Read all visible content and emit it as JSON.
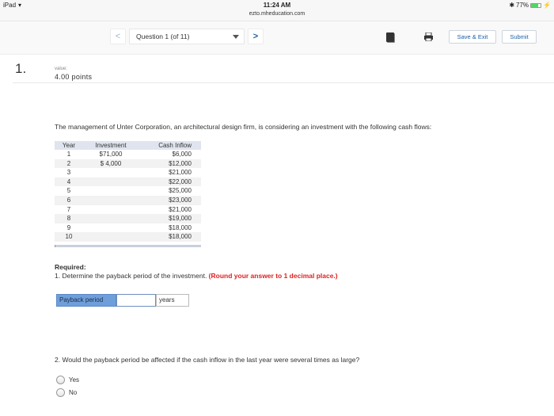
{
  "status_bar": {
    "device": "iPad",
    "time": "11:24 AM",
    "url": "ezto.mheducation.com",
    "battery_percent": "77%",
    "battery_level": 0.77
  },
  "toolbar": {
    "prev_label": "<",
    "next_label": ">",
    "question_select": "Question 1 (of 11)",
    "save_exit_label": "Save & Exit",
    "submit_label": "Submit"
  },
  "question": {
    "number": "1.",
    "value_label": "value:",
    "points": "4.00 points",
    "intro": "The management of Unter Corporation, an architectural design firm, is considering an investment with the following cash flows:",
    "table": {
      "headers": [
        "Year",
        "Investment",
        "Cash Inflow"
      ],
      "rows": [
        [
          "1",
          "$71,000",
          "$6,000"
        ],
        [
          "2",
          "$ 4,000",
          "$12,000"
        ],
        [
          "3",
          "",
          "$21,000"
        ],
        [
          "4",
          "",
          "$22,000"
        ],
        [
          "5",
          "",
          "$25,000"
        ],
        [
          "6",
          "",
          "$23,000"
        ],
        [
          "7",
          "",
          "$21,000"
        ],
        [
          "8",
          "",
          "$19,000"
        ],
        [
          "9",
          "",
          "$18,000"
        ],
        [
          "10",
          "",
          "$18,000"
        ]
      ]
    },
    "required_label": "Required:",
    "part1_text": "1. Determine the payback period of the investment. ",
    "part1_note": "(Round your answer to 1 decimal place.)",
    "payback_label": "Payback period",
    "payback_value": "",
    "payback_unit": "years",
    "part2_text": "2. Would the payback period be affected if the cash inflow in the last year were several times as large?",
    "options": [
      "Yes",
      "No"
    ]
  },
  "colors": {
    "accent": "#1a5fa8",
    "payback_label_bg": "#6f9fdb",
    "note_red": "#e02020",
    "table_header_bg": "#dfe4ee"
  }
}
